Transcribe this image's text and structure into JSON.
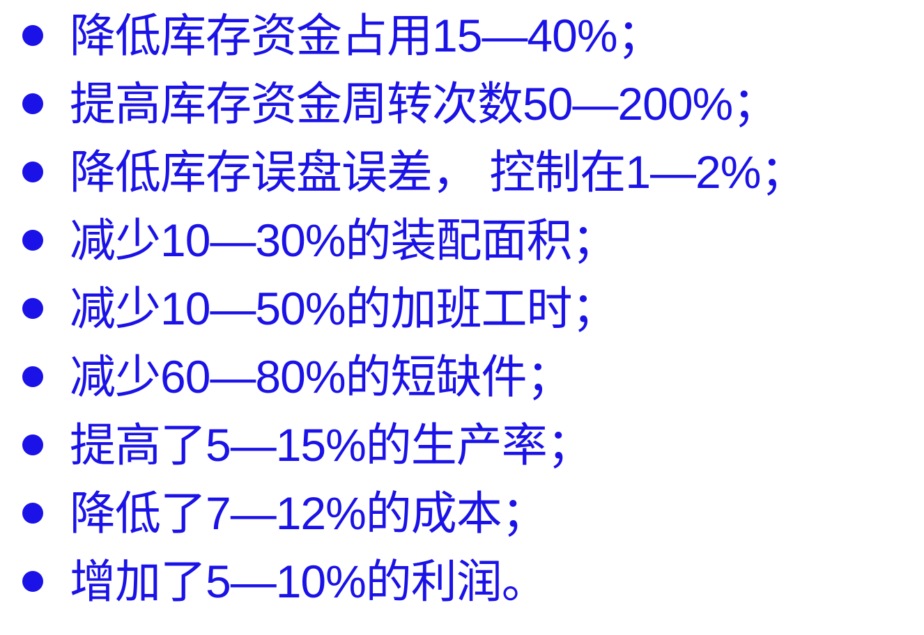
{
  "slide": {
    "text_color": "#1a12e6",
    "background_color": "#ffffff",
    "bullet_icon": "filled-circle-bullet",
    "items": [
      {
        "text": "降低库存资金占用15—40%；"
      },
      {
        "text": "提高库存资金周转次数50—200%；"
      },
      {
        "text": "降低库存误盘误差， 控制在1—2%；"
      },
      {
        "text": "减少10—30%的装配面积；"
      },
      {
        "text": "减少10—50%的加班工时；"
      },
      {
        "text": "减少60—80%的短缺件；"
      },
      {
        "text": "提高了5—15%的生产率；"
      },
      {
        "text": "降低了7—12%的成本；"
      },
      {
        "text": "增加了5—10%的利润。"
      }
    ]
  }
}
